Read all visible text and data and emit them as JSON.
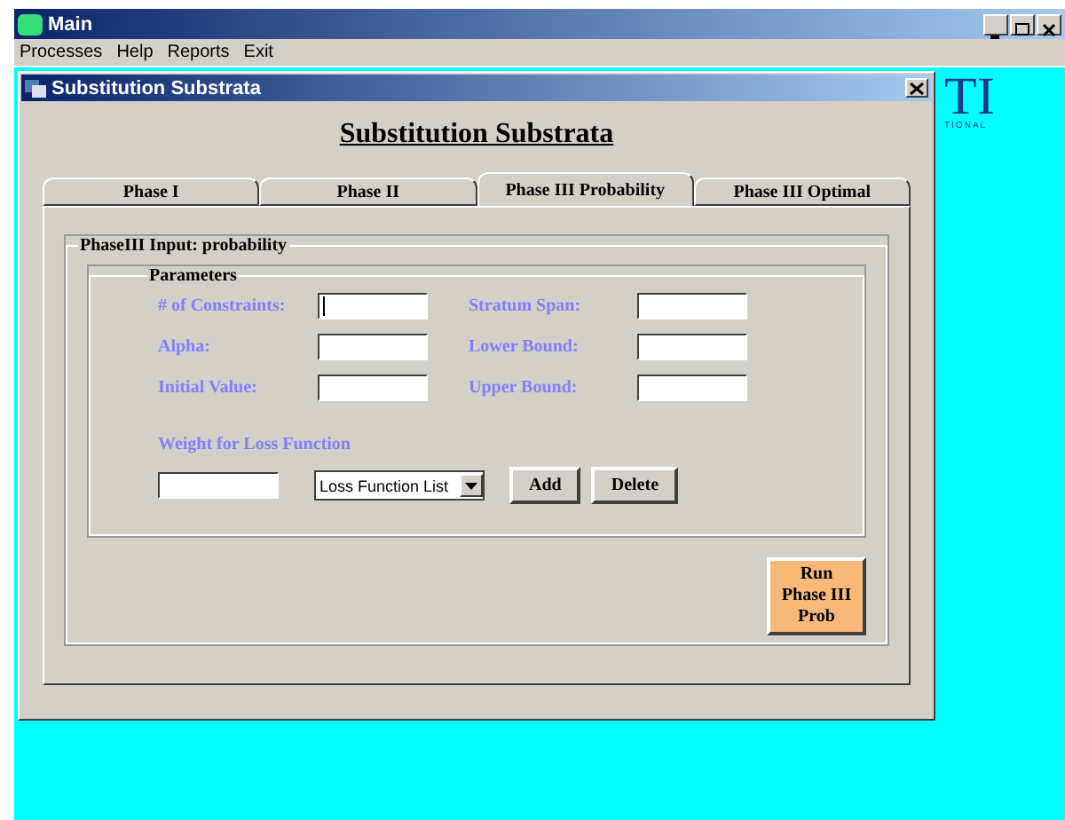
{
  "window": {
    "title": "Main"
  },
  "menu": [
    "Processes",
    "Help",
    "Reports",
    "Exit"
  ],
  "logo": {
    "mark": "TI",
    "subtitle": "TIONAL"
  },
  "dialog": {
    "title": "Substitution Substrata",
    "heading": "Substitution Substrata",
    "tabs": [
      {
        "label": "Phase I",
        "selected": false
      },
      {
        "label": "Phase II",
        "selected": false
      },
      {
        "label": "Phase III Probability",
        "selected": true
      },
      {
        "label": "Phase III Optimal",
        "selected": false
      }
    ],
    "group": "PhaseIII Input: probability",
    "parameters": {
      "title": "Parameters",
      "fields": [
        {
          "label": "# of Constraints:",
          "cursor": true
        },
        {
          "label": "Stratum Span:",
          "cursor": false
        },
        {
          "label": "Alpha:",
          "cursor": false
        },
        {
          "label": "Lower Bound:",
          "cursor": false
        },
        {
          "label": "Initial Value:",
          "cursor": false
        },
        {
          "label": "Upper Bound:",
          "cursor": false
        }
      ],
      "weight_label": "Weight for Loss Function",
      "dropdown": "Loss Function List",
      "buttons": [
        "Add",
        "Delete"
      ]
    },
    "run_button": [
      "Run",
      "Phase III",
      "Prob"
    ]
  }
}
